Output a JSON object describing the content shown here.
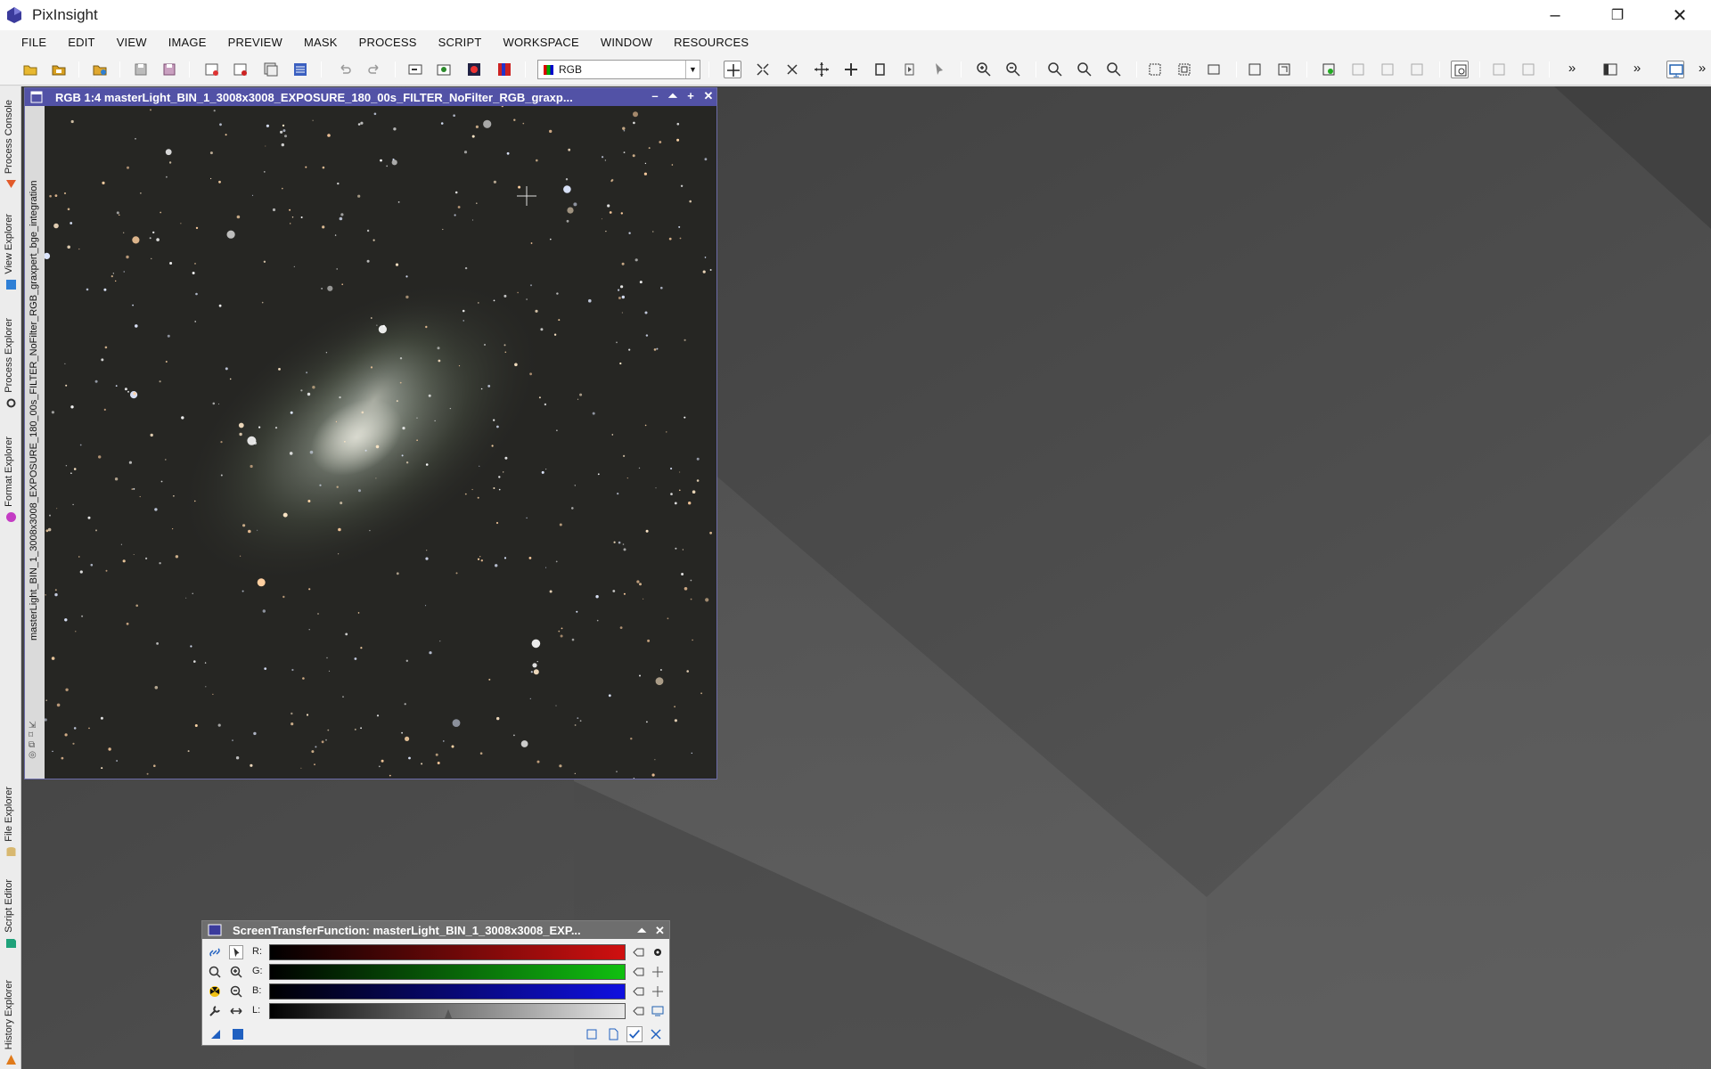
{
  "app": {
    "title": "PixInsight"
  },
  "menu": [
    "FILE",
    "EDIT",
    "VIEW",
    "IMAGE",
    "PREVIEW",
    "MASK",
    "PROCESS",
    "SCRIPT",
    "WORKSPACE",
    "WINDOW",
    "RESOURCES"
  ],
  "toolbar": {
    "view_select_value": "RGB"
  },
  "dock_tabs": [
    "Process Console",
    "View Explorer",
    "Process Explorer",
    "Format Explorer",
    "File Explorer",
    "Script Editor",
    "History Explorer"
  ],
  "image_window": {
    "title": "RGB 1:4 masterLight_BIN_1_3008x3008_EXPOSURE_180_00s_FILTER_NoFilter_RGB_graxp...",
    "side_label": "masterLight_BIN_1_3008x3008_EXPOSURE_180_00s_FILTER_NoFilter_RGB_graxpert_bge_integration"
  },
  "stf": {
    "title": "ScreenTransferFunction: masterLight_BIN_1_3008x3008_EXP...",
    "channels": [
      {
        "label": "R:",
        "color": "#d01010"
      },
      {
        "label": "G:",
        "color": "#10c010"
      },
      {
        "label": "B:",
        "color": "#1010e0"
      },
      {
        "label": "L:",
        "color": "#d8d8d8"
      }
    ]
  },
  "colors": {
    "window_title": "#5252a6",
    "panel_title": "#6e6e6e",
    "desktop": "#4c4c4c"
  }
}
